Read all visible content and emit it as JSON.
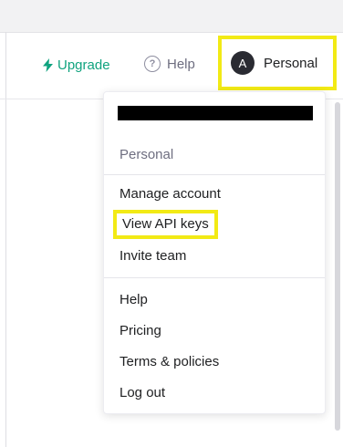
{
  "header": {
    "upgrade_label": "Upgrade",
    "help_label": "Help",
    "help_icon_glyph": "?",
    "account": {
      "avatar_letter": "A",
      "label": "Personal"
    }
  },
  "dropdown": {
    "section_label": "Personal",
    "group1": [
      "Manage account",
      "View API keys",
      "Invite team"
    ],
    "group2": [
      "Help",
      "Pricing",
      "Terms & policies",
      "Log out"
    ]
  },
  "colors": {
    "accent": "#10a37f",
    "highlight": "#f2ea15",
    "avatar_bg": "#2a2b32"
  }
}
